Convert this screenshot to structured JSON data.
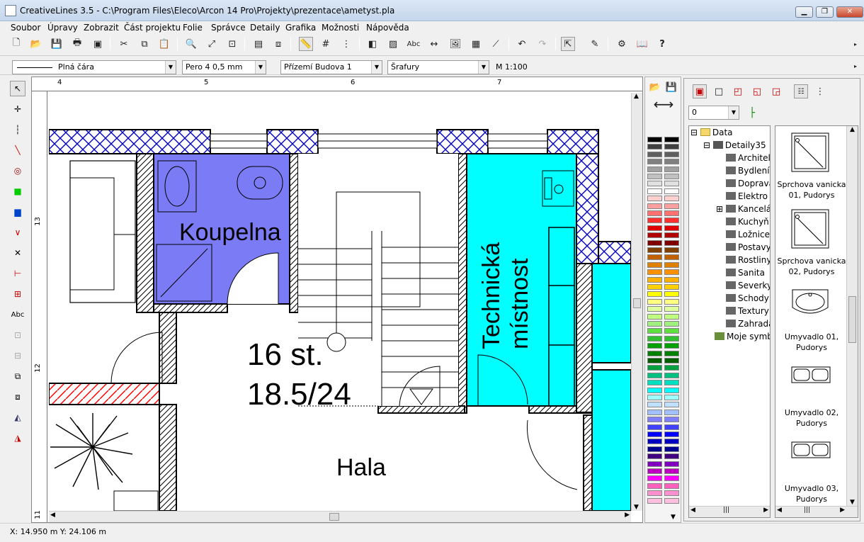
{
  "window": {
    "title": "CreativeLines 3.5  - C:\\Program Files\\Eleco\\Arcon 14 Pro\\Projekty\\prezentace\\ametyst.pla"
  },
  "menu": [
    "Soubor",
    "Úpravy",
    "Zobrazit",
    "Část projektu",
    "Folie",
    "Správce",
    "Detaily",
    "Grafika",
    "Možnosti",
    "Nápověda"
  ],
  "properties": {
    "line_style": "Plná čára",
    "pen": "Pero 4  0,5 mm",
    "layer": "Přízemí Budova 1",
    "hatch": "Šrafury",
    "scale": "M 1:100"
  },
  "ruler": {
    "h_labels": [
      "4",
      "5",
      "6",
      "7"
    ],
    "v_labels": [
      "13",
      "12",
      "11"
    ]
  },
  "drawing": {
    "room_koupelna": "Koupelna",
    "room_technicka_1": "Technická",
    "room_technicka_2": "místnost",
    "room_hala": "Hala",
    "stairs_1": "16 st.",
    "stairs_2": "18.5/24"
  },
  "colors": {
    "koupelna_fill": "#7b7bf5",
    "technicka_fill": "#00ffff",
    "hatch_blue": "#0000c0",
    "hatch_red": "#ff0000"
  },
  "library": {
    "level_value": "0",
    "tree": {
      "root": "Data",
      "folder": "Detaily35",
      "items": [
        "Architel",
        "Bydlení",
        "Doprava",
        "Elektro",
        "Kancelá",
        "Kuchyň",
        "Ložnice",
        "Postavy",
        "Rostliny",
        "Sanita",
        "Severky",
        "Schody",
        "Textury",
        "Zahrada"
      ],
      "user": "Moje symb"
    },
    "symbols": [
      {
        "l1": "Sprchova vanicka",
        "l2": "01,  Pudorys"
      },
      {
        "l1": "Sprchova vanicka",
        "l2": "02,  Pudorys"
      },
      {
        "l1": "Umyvadlo 01,",
        "l2": "Pudorys"
      },
      {
        "l1": "Umyvadlo 02,",
        "l2": "Pudorys"
      },
      {
        "l1": "Umyvadlo 03,",
        "l2": "Pudorys"
      }
    ]
  },
  "status": {
    "coords": "X: 14.950 m   Y: 24.106 m"
  },
  "palette": [
    "#000000",
    "#404040",
    "#606060",
    "#808080",
    "#a0a0a0",
    "#c0c0c0",
    "#e0e0e0",
    "#ffffff",
    "#ffd0d0",
    "#ffa0a0",
    "#ff7070",
    "#ff3030",
    "#e00000",
    "#b00000",
    "#800000",
    "#804000",
    "#c06000",
    "#e08000",
    "#ff9000",
    "#ffb000",
    "#ffd000",
    "#ffff00",
    "#ffff80",
    "#e0ffa0",
    "#c0ff80",
    "#a0f080",
    "#60e040",
    "#30c030",
    "#00a000",
    "#008000",
    "#006000",
    "#00a040",
    "#00c080",
    "#00e0c0",
    "#00ffff",
    "#a0ffff",
    "#c0e0ff",
    "#a0c0ff",
    "#8080ff",
    "#4040ff",
    "#0000ff",
    "#0000c0",
    "#000090",
    "#400080",
    "#8000c0",
    "#c000c0",
    "#ff00ff",
    "#ff60c0",
    "#ff90d0",
    "#ffc0e0"
  ]
}
